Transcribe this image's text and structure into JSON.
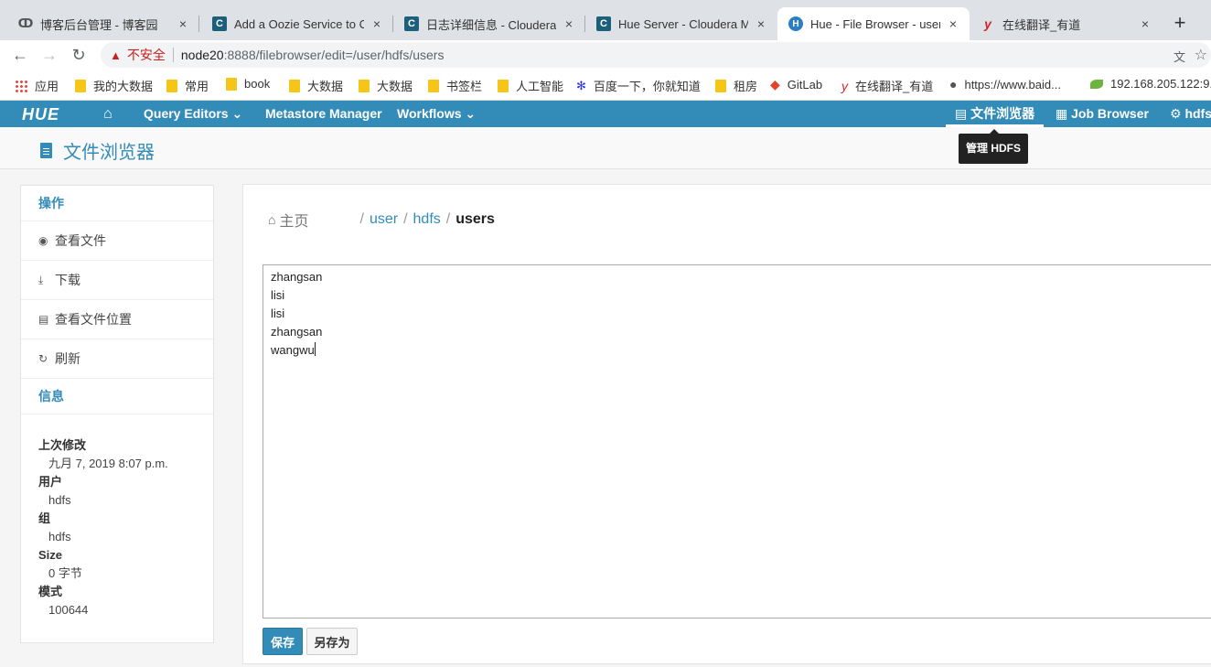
{
  "browser": {
    "tabs": [
      {
        "title": "博客后台管理 - 博客园",
        "favicon": "cnblogs-icon"
      },
      {
        "title": "Add a Oozie Service to Cl",
        "favicon": "cloudera-icon"
      },
      {
        "title": "日志详细信息 - Cloudera M",
        "favicon": "cloudera-icon"
      },
      {
        "title": "Hue Server - Cloudera Ma",
        "favicon": "cloudera-icon"
      },
      {
        "title": "Hue - File Browser - user",
        "favicon": "hue-icon",
        "active": true
      },
      {
        "title": "在线翻译_有道",
        "favicon": "youdao-icon"
      }
    ],
    "new_tab": "+",
    "close_glyph": "×",
    "address": {
      "security_label": "不安全",
      "host": "node20",
      "path": ":8888/filebrowser/edit=/user/hdfs/users"
    },
    "bookmarks": [
      {
        "label": "应用",
        "icon": "apps-grid-icon"
      },
      {
        "label": "我的大数据",
        "icon": "folder-icon"
      },
      {
        "label": "常用",
        "icon": "folder-icon"
      },
      {
        "label": "book",
        "icon": "folder-icon"
      },
      {
        "label": "大数据",
        "icon": "folder-icon"
      },
      {
        "label": "大数据",
        "icon": "folder-icon"
      },
      {
        "label": "书签栏",
        "icon": "folder-icon"
      },
      {
        "label": "人工智能",
        "icon": "folder-icon"
      },
      {
        "label": "百度一下，你就知道",
        "icon": "baidu-icon"
      },
      {
        "label": "租房",
        "icon": "folder-icon"
      },
      {
        "label": "GitLab",
        "icon": "gitlab-icon"
      },
      {
        "label": "在线翻译_有道",
        "icon": "youdao-icon"
      },
      {
        "label": "https://www.baid...",
        "icon": "globe-icon"
      },
      {
        "label": "192.168.205.122:9...",
        "icon": "leaf-icon"
      }
    ]
  },
  "hue": {
    "brand_color": "#338bb8",
    "nav": {
      "logo": "HUE",
      "query_editors": "Query Editors",
      "metastore": "Metastore Manager",
      "workflows": "Workflows",
      "file_browser": "文件浏览器",
      "job_browser": "Job Browser",
      "user": "hdfs"
    },
    "tooltip": "管理 HDFS",
    "page_title": "文件浏览器",
    "sidebar": {
      "actions_header": "操作",
      "actions": [
        {
          "label": "查看文件",
          "icon": "eye-icon"
        },
        {
          "label": "下载",
          "icon": "download-icon"
        },
        {
          "label": "查看文件位置",
          "icon": "file-location-icon"
        },
        {
          "label": "刷新",
          "icon": "refresh-icon"
        }
      ],
      "info_header": "信息",
      "info": [
        {
          "label": "上次修改",
          "value": "九月 7, 2019 8:07 p.m."
        },
        {
          "label": "用户",
          "value": "hdfs"
        },
        {
          "label": "组",
          "value": "hdfs"
        },
        {
          "label": "Size",
          "value": "0 字节"
        },
        {
          "label": "模式",
          "value": "100644"
        }
      ]
    },
    "breadcrumb": {
      "home": "主页",
      "parts": [
        "user",
        "hdfs"
      ],
      "current": "users"
    },
    "editor": {
      "lines": [
        "zhangsan",
        "lisi",
        "lisi",
        "zhangsan",
        "wangwu"
      ]
    },
    "buttons": {
      "save": "保存",
      "save_as": "另存为"
    }
  }
}
